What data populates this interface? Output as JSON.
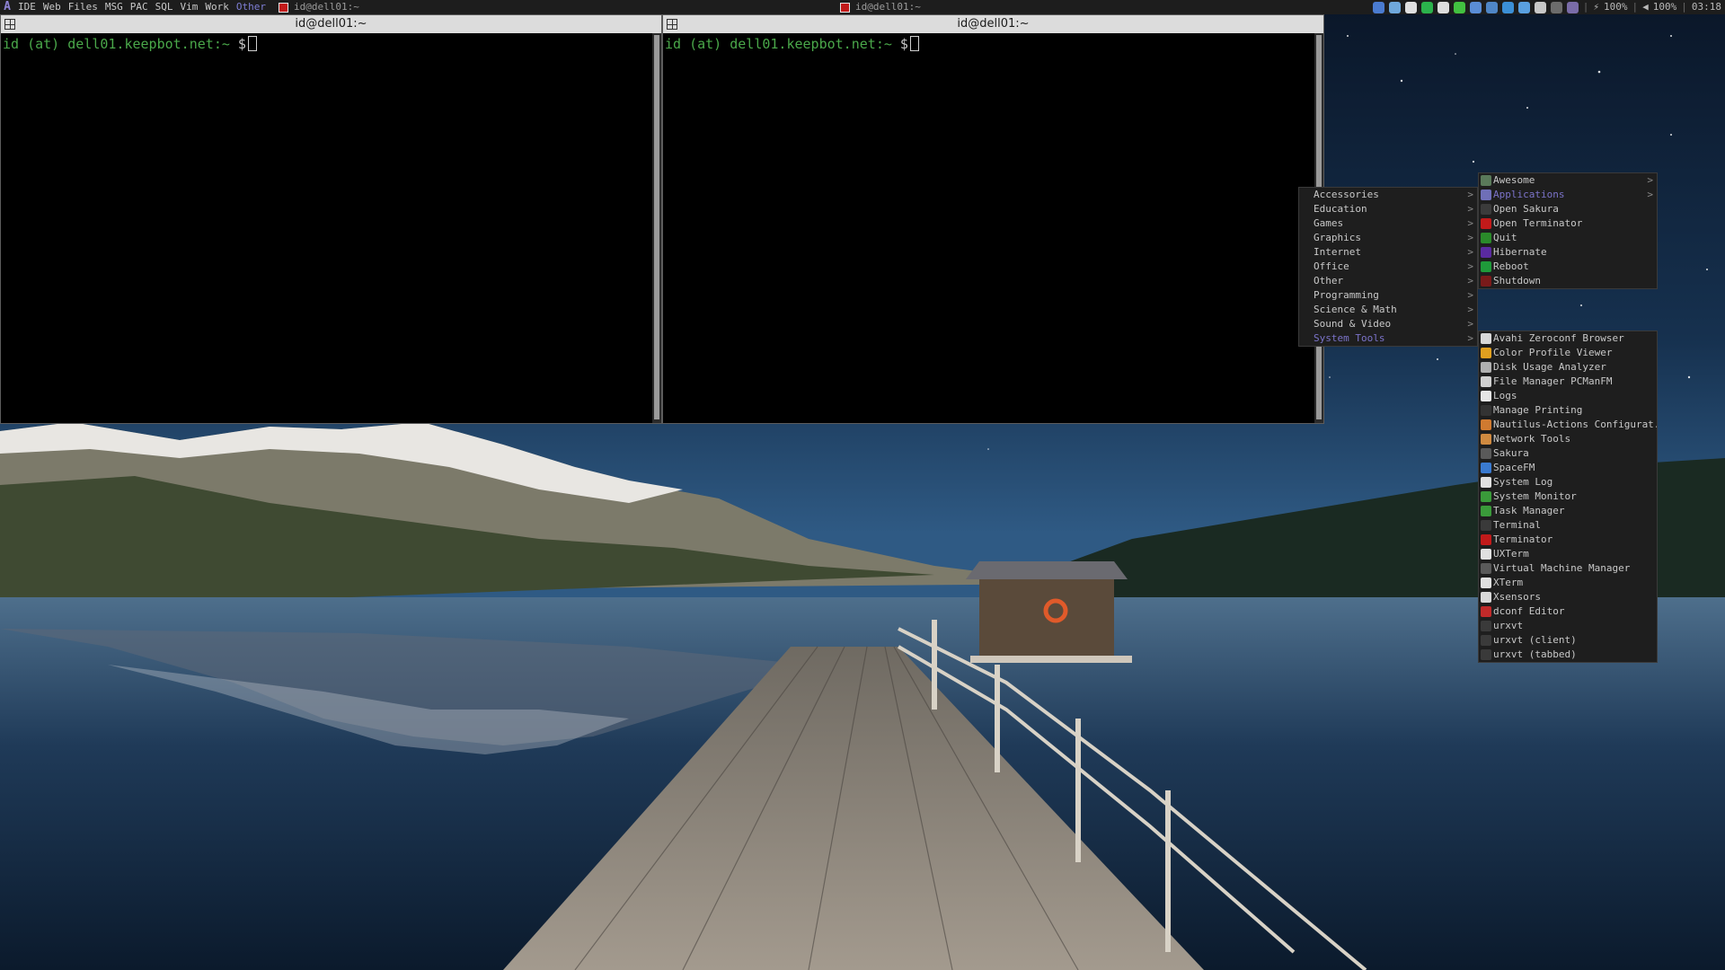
{
  "wibar": {
    "launcher_icon": "awesome-launcher-icon",
    "tags": [
      "IDE",
      "Web",
      "Files",
      "MSG",
      "PAC",
      "SQL",
      "Vim",
      "Work",
      "Other"
    ],
    "tasks": [
      {
        "label": "id@dell01:~",
        "icon": "terminator-icon",
        "focused": false
      },
      {
        "label": "id@dell01:~",
        "icon": "terminator-icon",
        "focused": false
      }
    ],
    "tray": {
      "icons": [
        "network-icon",
        "update-icon",
        "dropbox-icon",
        "checkmark-icon",
        "zim-icon",
        "chat-icon",
        "globe-icon",
        "dialog-icon",
        "browser-icon",
        "bars-icon",
        "flag-icon",
        "display-icon",
        "window-icon"
      ],
      "battery": "100%",
      "volume": "100%",
      "clock": "03:18",
      "colors": [
        "#4a7bd0",
        "#6fa8dc",
        "#e0e0e0",
        "#2bb24c",
        "#dddddd",
        "#42c040",
        "#5a8dd6",
        "#4f86c6",
        "#3b8fd6",
        "#5aa0e0",
        "#c8c8c8",
        "#6c6c6c",
        "#7a6ca8"
      ]
    }
  },
  "terminals": [
    {
      "title": "id@dell01:~",
      "prompt_user": "id (at) dell01.keepbot.net",
      "prompt_path": ":~ ",
      "prompt_symbol": "$"
    },
    {
      "title": "id@dell01:~",
      "prompt_user": "id (at) dell01.keepbot.net",
      "prompt_path": ":~ ",
      "prompt_symbol": "$"
    }
  ],
  "main_menu": {
    "items": [
      {
        "label": "Awesome",
        "icon": "awesome-icon",
        "color": "#5a7a5a",
        "submenu": true,
        "highlighted": false
      },
      {
        "label": "Applications",
        "icon": "applications-icon",
        "color": "#6f6fb8",
        "submenu": true,
        "highlighted": true
      },
      {
        "label": "Open Sakura",
        "icon": "sakura-icon",
        "color": "#3b3b3b",
        "submenu": false,
        "highlighted": false
      },
      {
        "label": "Open Terminator",
        "icon": "terminator-icon",
        "color": "#c21a1a",
        "submenu": false,
        "highlighted": false
      },
      {
        "label": "Quit",
        "icon": "quit-icon",
        "color": "#2a8a2a",
        "submenu": false,
        "highlighted": false
      },
      {
        "label": "Hibernate",
        "icon": "hibernate-icon",
        "color": "#5a2aa0",
        "submenu": false,
        "highlighted": false
      },
      {
        "label": "Reboot",
        "icon": "reboot-icon",
        "color": "#1f9a3a",
        "submenu": false,
        "highlighted": false
      },
      {
        "label": "Shutdown",
        "icon": "shutdown-icon",
        "color": "#7a1a1a",
        "submenu": false,
        "highlighted": false
      }
    ]
  },
  "categories_menu": {
    "items": [
      {
        "label": "Accessories",
        "highlighted": false
      },
      {
        "label": "Education",
        "highlighted": false
      },
      {
        "label": "Games",
        "highlighted": false
      },
      {
        "label": "Graphics",
        "highlighted": false
      },
      {
        "label": "Internet",
        "highlighted": false
      },
      {
        "label": "Office",
        "highlighted": false
      },
      {
        "label": "Other",
        "highlighted": false
      },
      {
        "label": "Programming",
        "highlighted": false
      },
      {
        "label": "Science & Math",
        "highlighted": false
      },
      {
        "label": "Sound & Video",
        "highlighted": false
      },
      {
        "label": "System Tools",
        "highlighted": true
      }
    ]
  },
  "system_tools_menu": {
    "items": [
      {
        "label": "Avahi Zeroconf Browser",
        "icon": "avahi-icon",
        "color": "#d8d8d8"
      },
      {
        "label": "Color Profile Viewer",
        "icon": "color-profile-icon",
        "color": "#e0a020"
      },
      {
        "label": "Disk Usage Analyzer",
        "icon": "disk-usage-icon",
        "color": "#b0b0b0"
      },
      {
        "label": "File Manager PCManFM",
        "icon": "pcmanfm-icon",
        "color": "#d0d0d0"
      },
      {
        "label": "Logs",
        "icon": "logs-icon",
        "color": "#e6e6e6"
      },
      {
        "label": "Manage Printing",
        "icon": "printer-icon",
        "color": "#333333"
      },
      {
        "label": "Nautilus-Actions Configurat...",
        "icon": "nautilus-actions-icon",
        "color": "#d07a30"
      },
      {
        "label": "Network Tools",
        "icon": "network-tools-icon",
        "color": "#d08a40"
      },
      {
        "label": "Sakura",
        "icon": "sakura-icon",
        "color": "#5a5a5a"
      },
      {
        "label": "SpaceFM",
        "icon": "spacefm-icon",
        "color": "#3a7ad0"
      },
      {
        "label": "System Log",
        "icon": "system-log-icon",
        "color": "#e0e0e0"
      },
      {
        "label": "System Monitor",
        "icon": "system-monitor-icon",
        "color": "#3a9a3a"
      },
      {
        "label": "Task Manager",
        "icon": "task-manager-icon",
        "color": "#3a9a3a"
      },
      {
        "label": "Terminal",
        "icon": "terminal-icon",
        "color": "#3a3a3a"
      },
      {
        "label": "Terminator",
        "icon": "terminator-icon",
        "color": "#c21a1a"
      },
      {
        "label": "UXTerm",
        "icon": "uxterm-icon",
        "color": "#e0e0e0"
      },
      {
        "label": "Virtual Machine Manager",
        "icon": "virt-manager-icon",
        "color": "#5a5a5a"
      },
      {
        "label": "XTerm",
        "icon": "xterm-icon",
        "color": "#e0e0e0"
      },
      {
        "label": "Xsensors",
        "icon": "xsensors-icon",
        "color": "#d8d8d8"
      },
      {
        "label": "dconf Editor",
        "icon": "dconf-icon",
        "color": "#c02a2a"
      },
      {
        "label": "urxvt",
        "icon": "urxvt-icon",
        "color": "#3a3a3a"
      },
      {
        "label": "urxvt (client)",
        "icon": "urxvt-client-icon",
        "color": "#3a3a3a"
      },
      {
        "label": "urxvt (tabbed)",
        "icon": "urxvt-tabbed-icon",
        "color": "#3a3a3a"
      }
    ]
  }
}
